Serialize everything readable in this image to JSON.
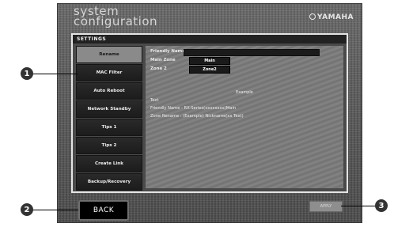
{
  "header": {
    "title_line1": "system",
    "title_line2": "configuration",
    "brand": "YAMAHA"
  },
  "panel": {
    "title": "SETTINGS"
  },
  "sidebar": {
    "items": [
      {
        "label": "Rename"
      },
      {
        "label": "MAC Filter"
      },
      {
        "label": "Auto Reboot"
      },
      {
        "label": "Network Standby"
      },
      {
        "label": "Tips 1"
      },
      {
        "label": "Tips 2"
      },
      {
        "label": "Create Link"
      },
      {
        "label": "Backup/Recovery"
      }
    ]
  },
  "content": {
    "friendly_name_label": "Friendly Name",
    "main_zone_label": "Main Zone",
    "main_zone_button": "Main",
    "zone2_label": "Zone 2",
    "zone2_button": "Zone2",
    "center_label": "Example",
    "info_heading": "Text",
    "info_line1": "Friendly Name : RX-Series(xxxxxxxx)Main",
    "info_line2": "Zone Rename : (Example) Nickname(xx Text)"
  },
  "footer": {
    "back_label": "BACK",
    "apply_label": "APPLY"
  },
  "callouts": [
    "1",
    "2",
    "3"
  ]
}
